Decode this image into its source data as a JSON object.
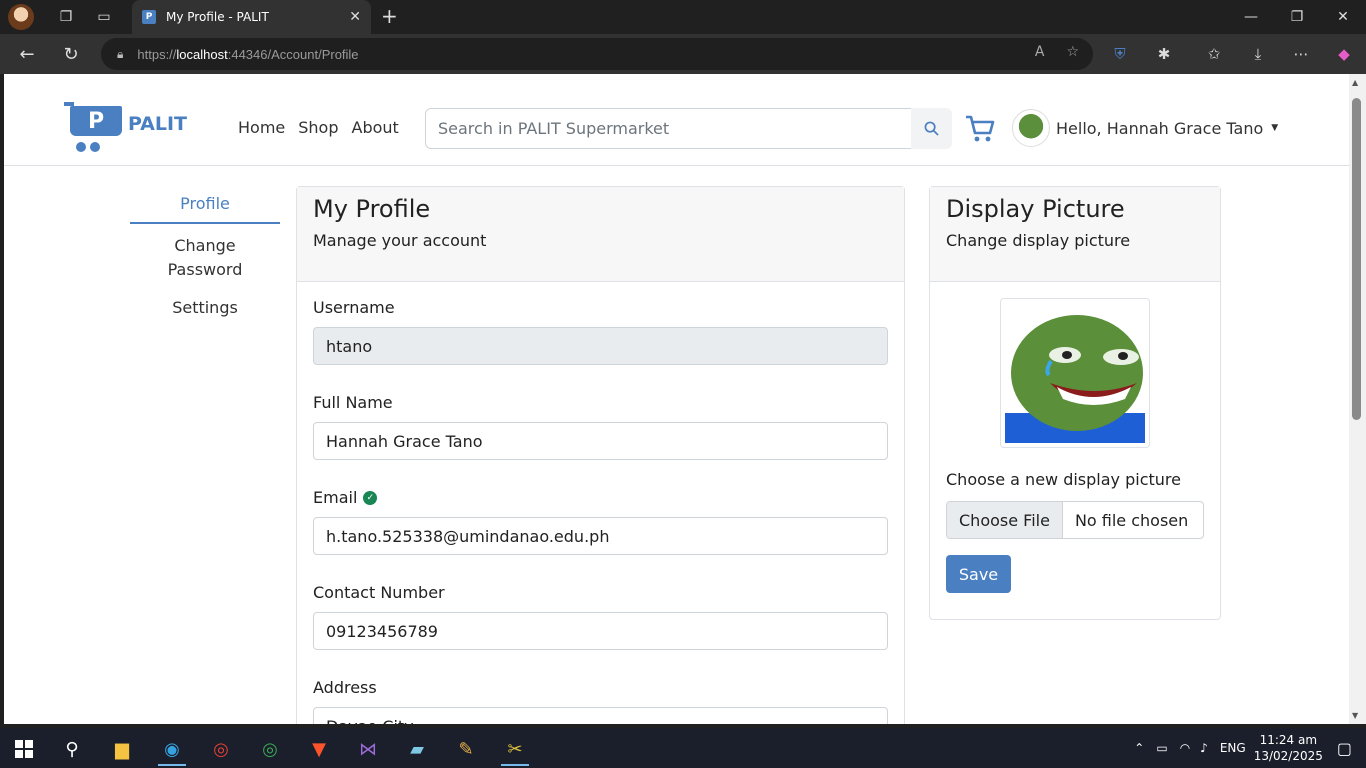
{
  "browser": {
    "tab_title": "My Profile - PALIT",
    "tab_favicon": "P",
    "url_prefix": "https://",
    "url_host": "localhost",
    "url_rest": ":44346/Account/Profile"
  },
  "site": {
    "logo_letter": "P",
    "logo_text": "PALIT",
    "nav": [
      "Home",
      "Shop",
      "About"
    ],
    "search_placeholder": "Search in PALIT Supermarket",
    "user_greeting": "Hello, Hannah Grace Tano"
  },
  "sidebar": {
    "items": [
      {
        "label": "Profile",
        "active": true
      },
      {
        "label": "Change Password",
        "active": false
      },
      {
        "label": "Settings",
        "active": false
      }
    ]
  },
  "profile": {
    "title": "My Profile",
    "subtitle": "Manage your account",
    "fields": [
      {
        "label": "Username",
        "value": "htano",
        "readonly": true
      },
      {
        "label": "Full Name",
        "value": "Hannah Grace Tano"
      },
      {
        "label": "Email",
        "value": "h.tano.525338@umindanao.edu.ph",
        "verified": true
      },
      {
        "label": "Contact Number",
        "value": "09123456789"
      },
      {
        "label": "Address",
        "value": "Davao City"
      }
    ]
  },
  "picture": {
    "title": "Display Picture",
    "subtitle": "Change display picture",
    "choose_label": "Choose a new display picture",
    "file_button": "Choose File",
    "file_status": "No file chosen",
    "save_label": "Save"
  },
  "taskbar": {
    "lang": "ENG",
    "time": "11:24 am",
    "date": "13/02/2025"
  },
  "colors": {
    "accent": "#4a7fc1",
    "verified": "#198754"
  }
}
